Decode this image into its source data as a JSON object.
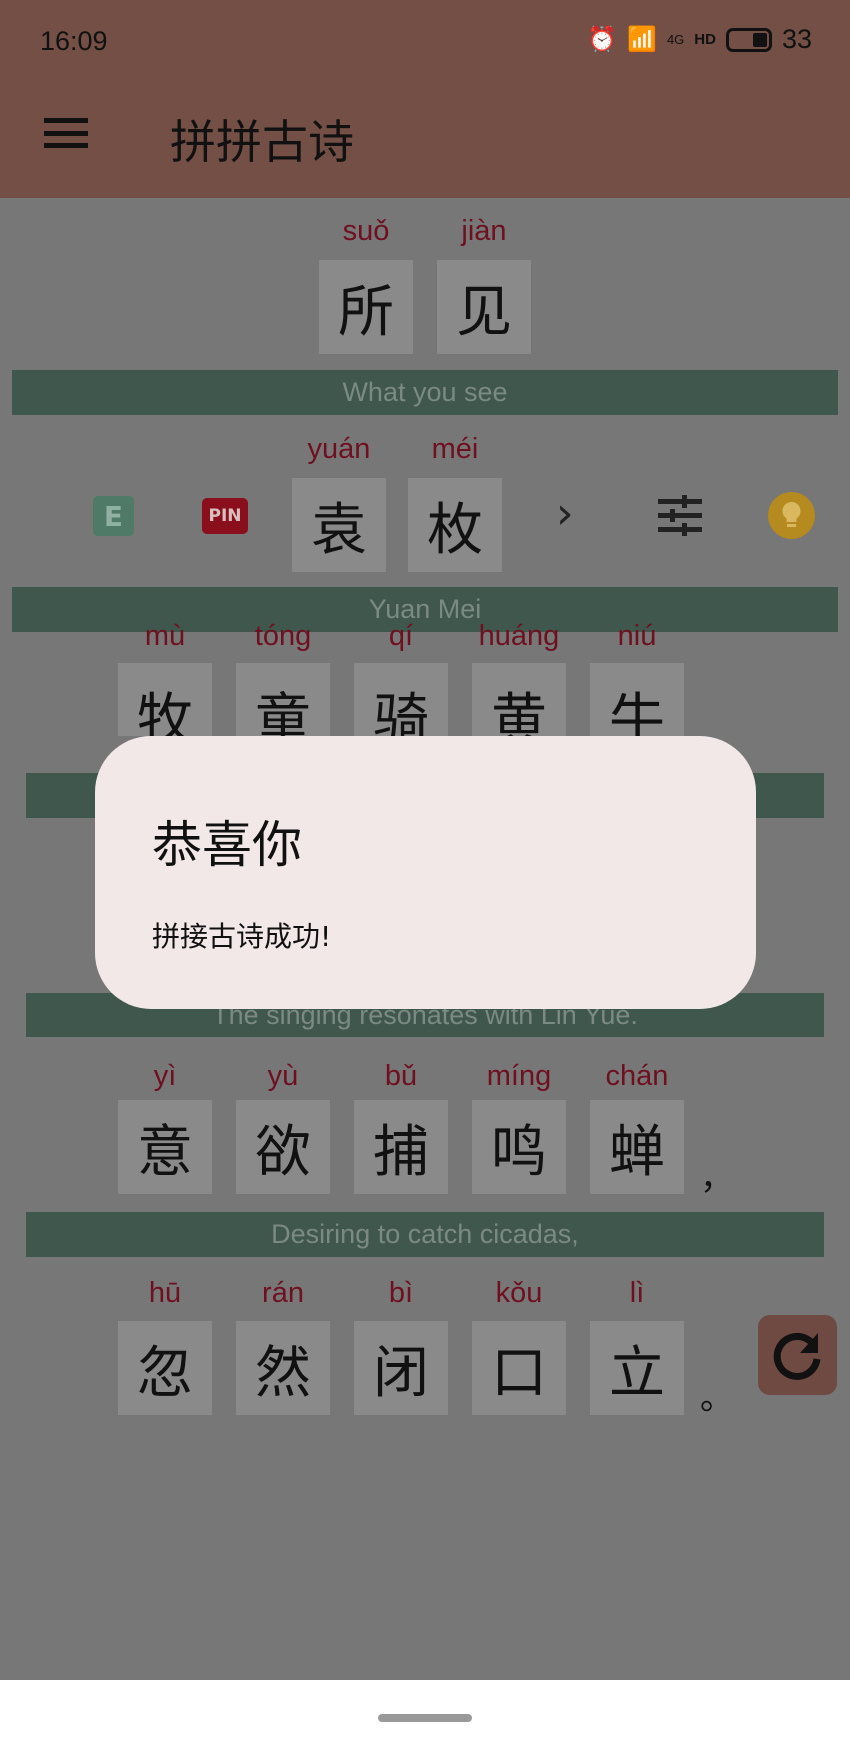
{
  "status_bar": {
    "time": "16:09",
    "network": "4G",
    "hd": "HD",
    "battery": "33"
  },
  "header": {
    "title": "拼拼古诗"
  },
  "poem": {
    "title": {
      "chars": [
        "所",
        "见"
      ],
      "pinyin": [
        "suǒ",
        "jiàn"
      ],
      "translation": "What you see"
    },
    "author": {
      "chars": [
        "袁",
        "枚"
      ],
      "pinyin": [
        "yuán",
        "méi"
      ],
      "translation": "Yuan Mei"
    },
    "lines": [
      {
        "chars": [
          "牧",
          "童",
          "骑",
          "黄",
          "牛"
        ],
        "pinyin": [
          "mù",
          "tóng",
          "qí",
          "huáng",
          "niú"
        ]
      },
      {
        "translation": "The singing resonates with Lin Yue."
      },
      {
        "chars": [
          "意",
          "欲",
          "捕",
          "鸣",
          "蝉"
        ],
        "pinyin": [
          "yì",
          "yù",
          "bǔ",
          "míng",
          "chán"
        ],
        "punct": "，",
        "translation": "Desiring to catch cicadas,"
      },
      {
        "chars": [
          "忽",
          "然",
          "闭",
          "口",
          "立"
        ],
        "pinyin": [
          "hū",
          "rán",
          "bì",
          "kǒu",
          "lì"
        ],
        "punct": "。"
      }
    ]
  },
  "toolbar": {
    "english_label": "E",
    "pinyin_label": "PIN",
    "next": "›",
    "colors": {
      "english": "#4f7a68",
      "pinyin": "#8a0f1c",
      "hint": "#b58a1e"
    }
  },
  "dialog": {
    "title": "恭喜你",
    "message": "拼接古诗成功!"
  }
}
